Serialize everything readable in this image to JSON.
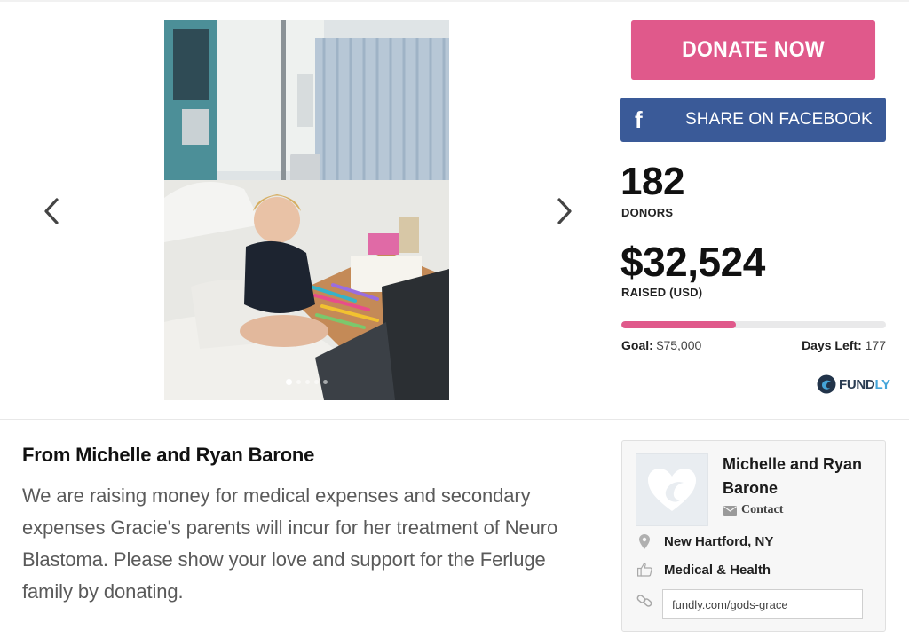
{
  "carousel": {
    "prev_icon": "chevron-left-icon",
    "next_icon": "chevron-right-icon",
    "slide_count": 5,
    "active_slide": 1
  },
  "actions": {
    "donate_label": "DONATE NOW",
    "share_label": "SHARE ON FACEBOOK",
    "share_icon": "facebook-icon",
    "donate_color": "#e0598b",
    "facebook_color": "#3a5a98"
  },
  "stats": {
    "donors_count": "182",
    "donors_label": "DONORS",
    "raised_amount": "$32,524",
    "raised_label": "RAISED (USD)",
    "progress_fraction": 0.434,
    "goal_label": "Goal:",
    "goal_value": "$75,000",
    "days_left_label": "Days Left:",
    "days_left_value": "177"
  },
  "brand": {
    "logo_name": "FUNDLY"
  },
  "story": {
    "title": "From Michelle and Ryan Barone",
    "body": "We are raising money for medical expenses and secondary expenses Gracie's parents will incur for her treatment of Neuro Blastoma. Please show your love and support for the Ferluge family by donating."
  },
  "organizer": {
    "name": "Michelle and Ryan Barone",
    "contact_label": "Contact",
    "location": "New Hartford, NY",
    "category": "Medical & Health",
    "url": "fundly.com/gods-grace"
  }
}
